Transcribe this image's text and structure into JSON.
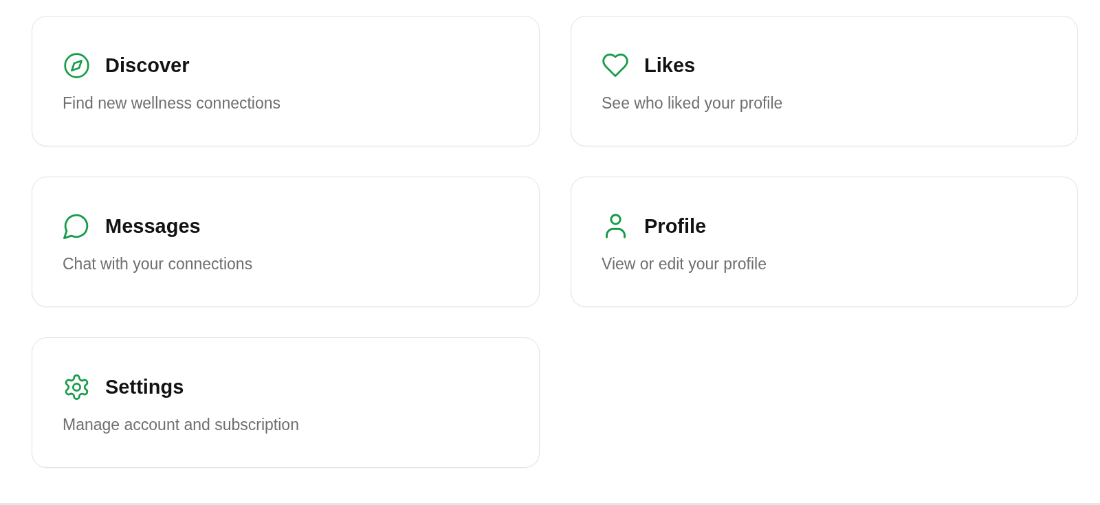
{
  "cards": [
    {
      "kind": "compass",
      "title": "Discover",
      "description": "Find new wellness connections"
    },
    {
      "kind": "heart",
      "title": "Likes",
      "description": "See who liked your profile"
    },
    {
      "kind": "chat",
      "title": "Messages",
      "description": "Chat with your connections"
    },
    {
      "kind": "person",
      "title": "Profile",
      "description": "View or edit your profile"
    },
    {
      "kind": "gear",
      "title": "Settings",
      "description": "Manage account and subscription"
    }
  ]
}
